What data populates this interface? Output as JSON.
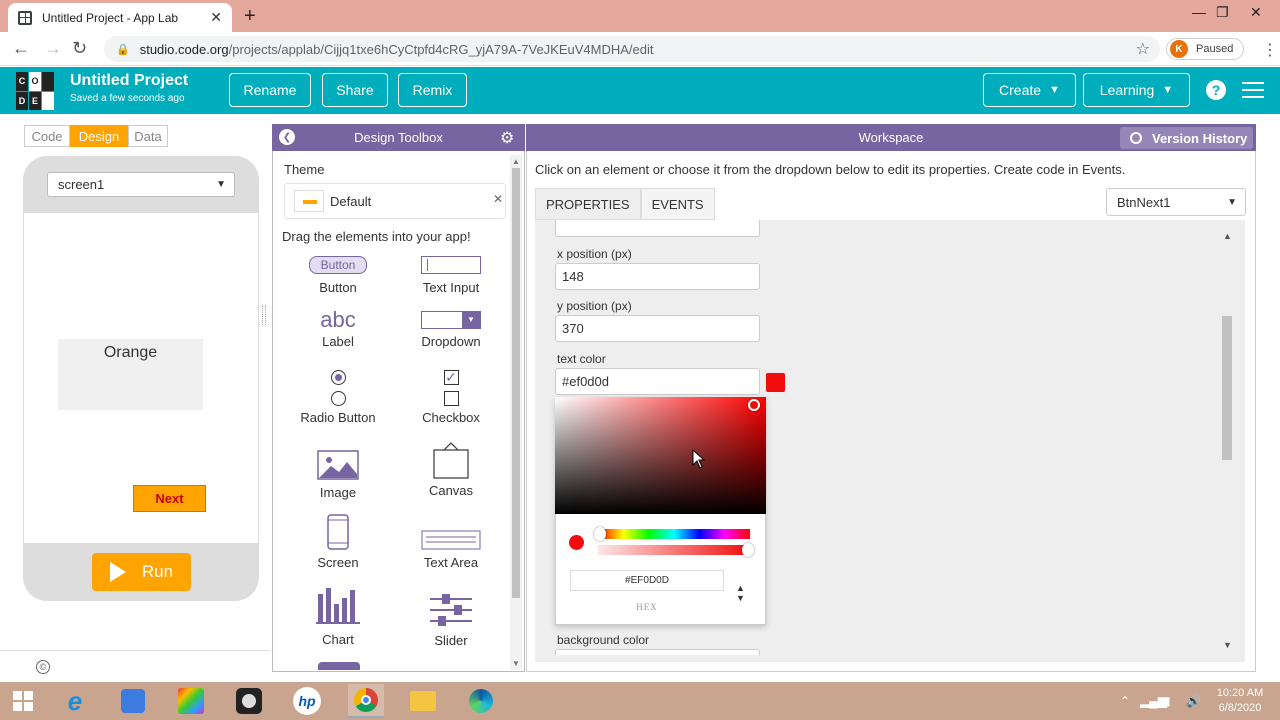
{
  "browser": {
    "tab_title": "Untitled Project - App Lab",
    "url_host": "studio.code.org",
    "url_path": "/projects/applab/Cijjq1txe6hCyCtpfd4cRG_yjA79A-7VeJKEuV4MDHA/edit",
    "profile_initial": "K",
    "profile_status": "Paused"
  },
  "app_header": {
    "logo_letters": [
      "C",
      "O",
      "D",
      "E"
    ],
    "project_title": "Untitled Project",
    "saved_status": "Saved a few seconds ago",
    "buttons": {
      "rename": "Rename",
      "share": "Share",
      "remix": "Remix",
      "create": "Create",
      "learning": "Learning"
    },
    "help_label": "?"
  },
  "left_panel": {
    "modes": [
      "Code",
      "Design",
      "Data"
    ],
    "active_mode": "Design",
    "screen_select": "screen1",
    "app_elements": {
      "label_text": "Orange",
      "button_text": "Next"
    },
    "run_label": "Run",
    "copyright_symbol": "©"
  },
  "toolbox": {
    "title": "Design Toolbox",
    "theme_label": "Theme",
    "theme_value": "Default",
    "drag_instruction": "Drag the elements into your app!",
    "items": [
      {
        "label": "Button",
        "icon": "button-icon",
        "icon_text": "Button"
      },
      {
        "label": "Text Input",
        "icon": "text-input-icon"
      },
      {
        "label": "Label",
        "icon": "label-icon",
        "icon_text": "abc"
      },
      {
        "label": "Dropdown",
        "icon": "dropdown-icon"
      },
      {
        "label": "Radio Button",
        "icon": "radio-button-icon"
      },
      {
        "label": "Checkbox",
        "icon": "checkbox-icon"
      },
      {
        "label": "Image",
        "icon": "image-icon"
      },
      {
        "label": "Canvas",
        "icon": "canvas-icon"
      },
      {
        "label": "Screen",
        "icon": "screen-icon"
      },
      {
        "label": "Text Area",
        "icon": "text-area-icon"
      },
      {
        "label": "Chart",
        "icon": "chart-icon"
      },
      {
        "label": "Slider",
        "icon": "slider-icon"
      }
    ]
  },
  "workspace": {
    "title": "Workspace",
    "version_history": "Version History",
    "instruction": "Click on an element or choose it from the dropdown below to edit its properties. Create code in Events.",
    "tabs": [
      "PROPERTIES",
      "EVENTS"
    ],
    "element_select": "BtnNext1",
    "properties": {
      "x_label": "x position (px)",
      "x_value": "148",
      "y_label": "y position (px)",
      "y_value": "370",
      "text_color_label": "text color",
      "text_color_value": "#ef0d0d",
      "background_color_label": "background color"
    },
    "color_picker": {
      "hex_value": "#EF0D0D",
      "mode_label": "HEX",
      "current_color": "#ef0d0d"
    }
  },
  "taskbar": {
    "time": "10:20 AM",
    "date": "6/8/2020"
  },
  "colors": {
    "header_teal": "#00adbc",
    "panel_purple": "#7665a0",
    "accent_orange": "#ffa400",
    "selected_text_color": "#ef0d0d"
  }
}
